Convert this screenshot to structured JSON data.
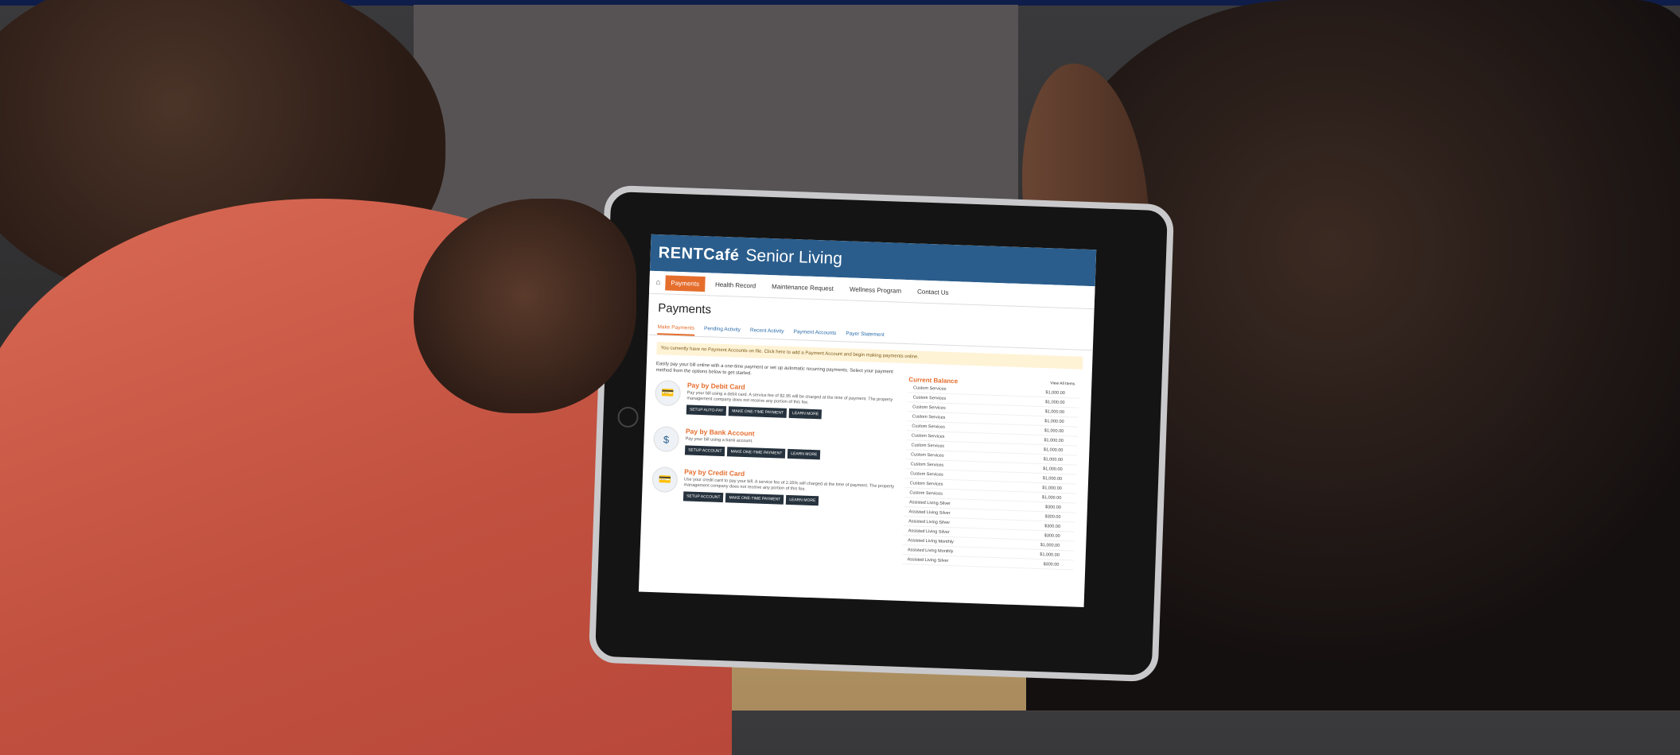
{
  "app": {
    "logo": "RENTCafé",
    "brand": "Senior Living"
  },
  "nav": {
    "home_glyph": "⌂",
    "items": [
      "Payments",
      "Health Record",
      "Maintenance Request",
      "Wellness Program",
      "Contact Us"
    ]
  },
  "page": {
    "title": "Payments"
  },
  "tabs": [
    "Make Payments",
    "Pending Activity",
    "Recent Activity",
    "Payment Accounts",
    "Payer Statement"
  ],
  "notice": "You currently have no Payment Accounts on file. Click here to add a Payment Account and begin making payments online.",
  "intro": "Easily pay your bill online with a one-time payment or set up automatic recurring payments. Select your payment method from the options below to get started.",
  "payment_options": [
    {
      "title": "Pay by Debit Card",
      "desc": "Pay your bill using a debit card. A service fee of $2.95 will be charged at the time of payment. The property management company does not receive any portion of this fee.",
      "icon": "debit-card-icon",
      "glyph": "💳",
      "buttons": [
        "SETUP AUTO-PAY",
        "MAKE ONE-TIME PAYMENT",
        "LEARN MORE"
      ]
    },
    {
      "title": "Pay by Bank Account",
      "desc": "Pay your bill using a bank account.",
      "icon": "bank-icon",
      "glyph": "$",
      "buttons": [
        "SETUP ACCOUNT",
        "MAKE ONE-TIME PAYMENT",
        "LEARN MORE"
      ]
    },
    {
      "title": "Pay by Credit Card",
      "desc": "Use your credit card to pay your bill. A service fee of 2.35% will charged at the time of payment. The property management company does not receive any portion of this fee.",
      "icon": "credit-card-icon",
      "glyph": "💳",
      "buttons": [
        "SETUP ACCOUNT",
        "MAKE ONE-TIME PAYMENT",
        "LEARN MORE"
      ]
    }
  ],
  "balance": {
    "title": "Current Balance",
    "link": "View All Items",
    "rows": [
      {
        "label": "Custom Services",
        "amount": "$1,000.00"
      },
      {
        "label": "Custom Services",
        "amount": "$1,000.00"
      },
      {
        "label": "Custom Services",
        "amount": "$1,000.00"
      },
      {
        "label": "Custom Services",
        "amount": "$1,000.00"
      },
      {
        "label": "Custom Services",
        "amount": "$1,000.00"
      },
      {
        "label": "Custom Services",
        "amount": "$1,000.00"
      },
      {
        "label": "Custom Services",
        "amount": "$1,000.00"
      },
      {
        "label": "Custom Services",
        "amount": "$1,000.00"
      },
      {
        "label": "Custom Services",
        "amount": "$1,000.00"
      },
      {
        "label": "Custom Services",
        "amount": "$1,000.00"
      },
      {
        "label": "Custom Services",
        "amount": "$1,000.00"
      },
      {
        "label": "Custom Services",
        "amount": "$1,000.00"
      },
      {
        "label": "Assisted Living Silver",
        "amount": "$300.00"
      },
      {
        "label": "Assisted Living Silver",
        "amount": "$300.00"
      },
      {
        "label": "Assisted Living Silver",
        "amount": "$300.00"
      },
      {
        "label": "Assisted Living Silver",
        "amount": "$300.00"
      },
      {
        "label": "Assisted Living Monthly",
        "amount": "$1,000.00"
      },
      {
        "label": "Assisted Living Monthly",
        "amount": "$1,000.00"
      },
      {
        "label": "Assisted Living Silver",
        "amount": "$300.00"
      }
    ]
  }
}
